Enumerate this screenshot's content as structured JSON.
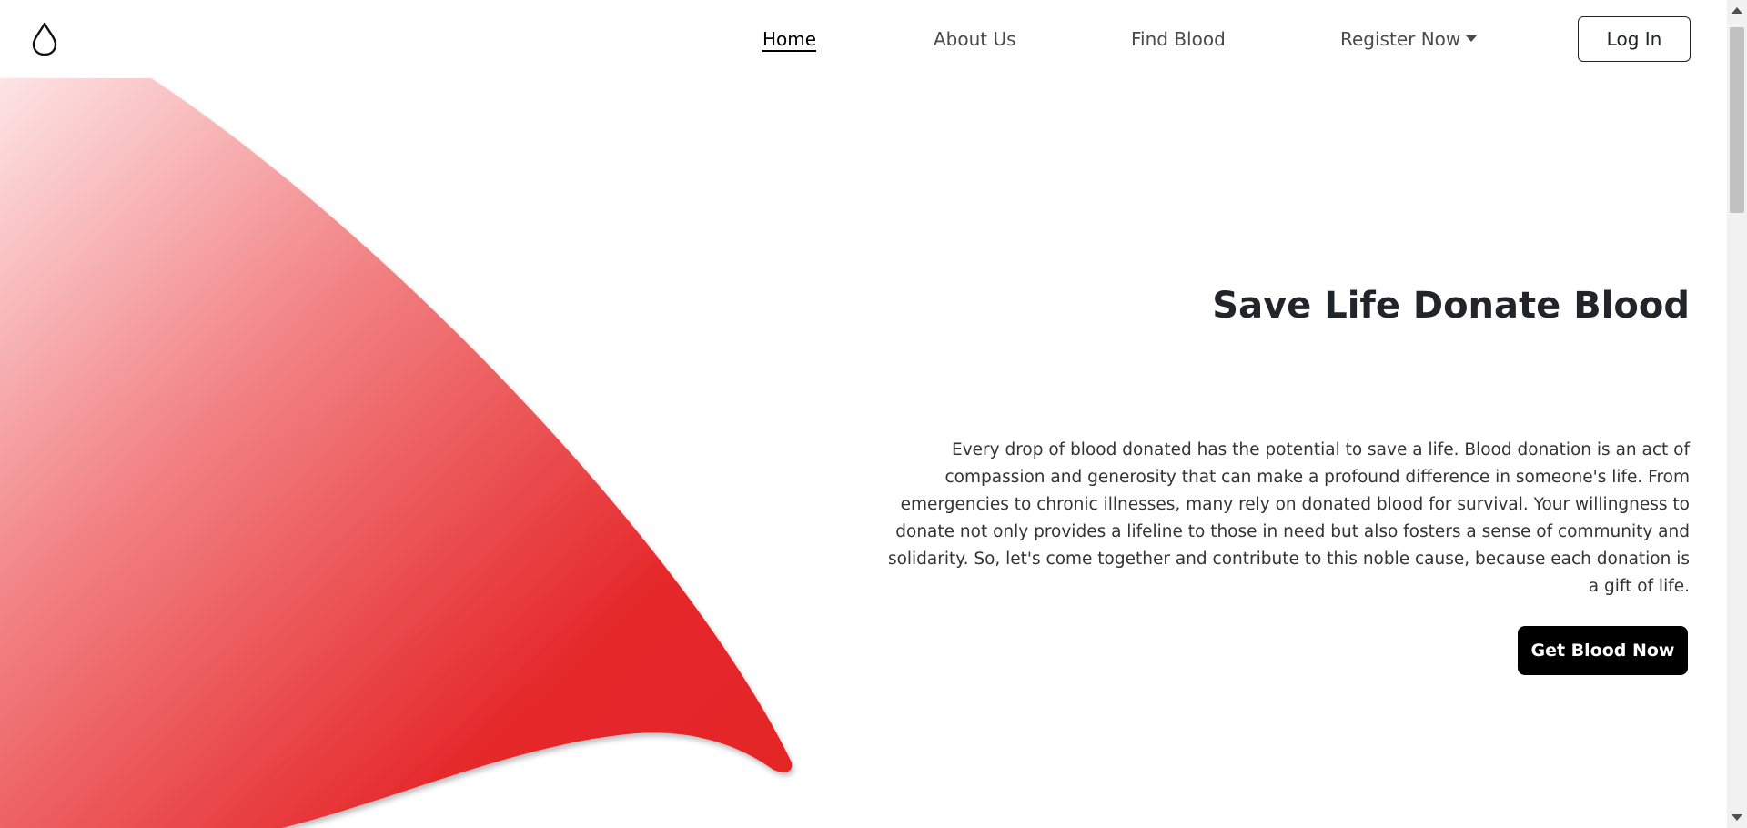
{
  "nav": {
    "logo_icon": "blood-drop-icon",
    "links": [
      {
        "label": "Home",
        "active": true
      },
      {
        "label": "About Us",
        "active": false
      },
      {
        "label": "Find Blood",
        "active": false
      },
      {
        "label": "Register Now",
        "active": false,
        "dropdown": true
      }
    ],
    "login_label": "Log In"
  },
  "hero": {
    "title": "Save Life Donate Blood",
    "body": "Every drop of blood donated has the potential to save a life. Blood donation is an act of compassion and generosity that can make a profound difference in someone's life. From emergencies to chronic illnesses, many rely on donated blood for survival. Your willingness to donate not only provides a lifeline to those in need but also fosters a sense of community and solidarity. So, let's come together and contribute to this noble cause, because each donation is a gift of life.",
    "cta_label": "Get Blood Now"
  },
  "colors": {
    "accent": "#e52628",
    "button": "#000000",
    "text": "#212529"
  }
}
